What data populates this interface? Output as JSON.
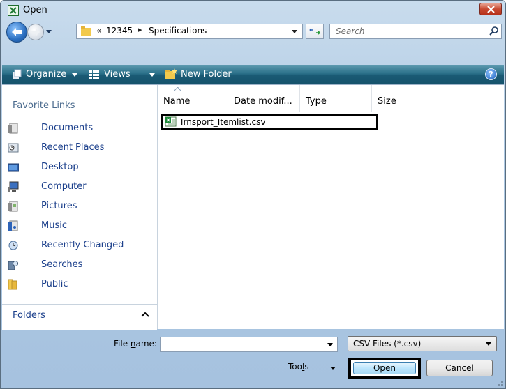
{
  "window": {
    "title": "Open"
  },
  "address": {
    "overflow": "«",
    "crumbs": [
      "12345",
      "Specifications"
    ],
    "separator": "▸"
  },
  "search": {
    "placeholder": "Search"
  },
  "toolbar": {
    "organize": "Organize",
    "views": "Views",
    "new_folder": "New Folder",
    "help": "?"
  },
  "favorites": {
    "heading": "Favorite Links",
    "items": [
      {
        "label": "Documents",
        "icon": "documents-icon"
      },
      {
        "label": "Recent Places",
        "icon": "recent-places-icon"
      },
      {
        "label": "Desktop",
        "icon": "desktop-icon"
      },
      {
        "label": "Computer",
        "icon": "computer-icon"
      },
      {
        "label": "Pictures",
        "icon": "pictures-icon"
      },
      {
        "label": "Music",
        "icon": "music-icon"
      },
      {
        "label": "Recently Changed",
        "icon": "recently-changed-icon"
      },
      {
        "label": "Searches",
        "icon": "searches-icon"
      },
      {
        "label": "Public",
        "icon": "public-folder-icon"
      }
    ],
    "folders_label": "Folders"
  },
  "files": {
    "columns": [
      "Name",
      "Date modif...",
      "Type",
      "Size"
    ],
    "rows": [
      {
        "name": "Trnsport_Itemlist.csv",
        "icon": "csv-file-icon"
      }
    ]
  },
  "bottom": {
    "file_name_label_pre": "File ",
    "file_name_label_ul": "n",
    "file_name_label_post": "ame:",
    "file_name_value": "",
    "filter": "CSV Files (*.csv)",
    "tools_pre": "Too",
    "tools_ul": "l",
    "tools_post": "s",
    "open_ul": "O",
    "open_post": "pen",
    "cancel": "Cancel"
  },
  "colors": {
    "accent": "#1b3f8b",
    "command_bar": "#2a6f88",
    "title_close": "#c84a31"
  }
}
